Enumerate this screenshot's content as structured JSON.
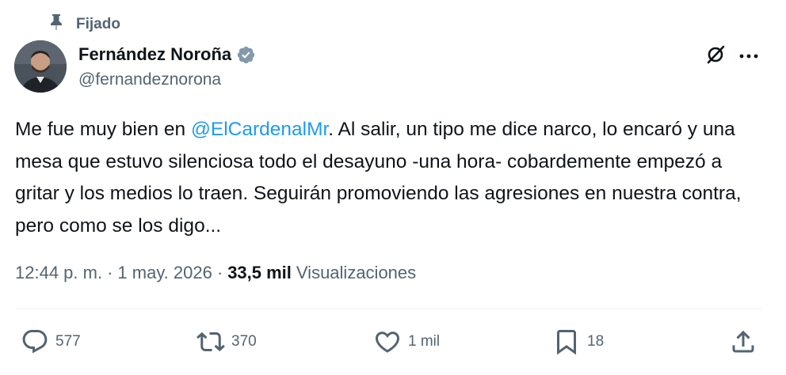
{
  "pinned": {
    "label": "Fijado",
    "icon": "pin-icon"
  },
  "author": {
    "display_name": "Fernández Noroña",
    "handle": "@fernandeznorona",
    "verified_icon": "verified-badge-icon",
    "verified_color": "#829aab"
  },
  "header_actions": {
    "grok_icon": "grok-icon",
    "more_icon": "more-options-icon"
  },
  "tweet": {
    "text_before_mention": "Me fue muy bien en ",
    "mention": "@ElCardenalMr",
    "text_after_mention": ". Al salir, un tipo me dice narco, lo encaró y una mesa que estuvo silenciosa todo el desayuno -una hora- cobardemente empezó a gritar y los medios lo traen. Seguirán promoviendo las agresiones en nuestra contra, pero como se los digo...",
    "mention_color": "#1d9bf0"
  },
  "meta": {
    "time": "12:44 p. m.",
    "separator": "·",
    "date": "1 may. 2026",
    "views_count": "33,5 mil",
    "views_label": "Visualizaciones"
  },
  "actions": {
    "replies": {
      "icon": "reply-icon",
      "count": "577"
    },
    "reposts": {
      "icon": "repost-icon",
      "count": "370"
    },
    "likes": {
      "icon": "like-icon",
      "count": "1 mil"
    },
    "bookmarks": {
      "icon": "bookmark-icon",
      "count": "18"
    },
    "share": {
      "icon": "share-icon"
    }
  },
  "colors": {
    "primary_text": "#0f1419",
    "secondary_text": "#536471",
    "divider": "#eff3f4"
  }
}
